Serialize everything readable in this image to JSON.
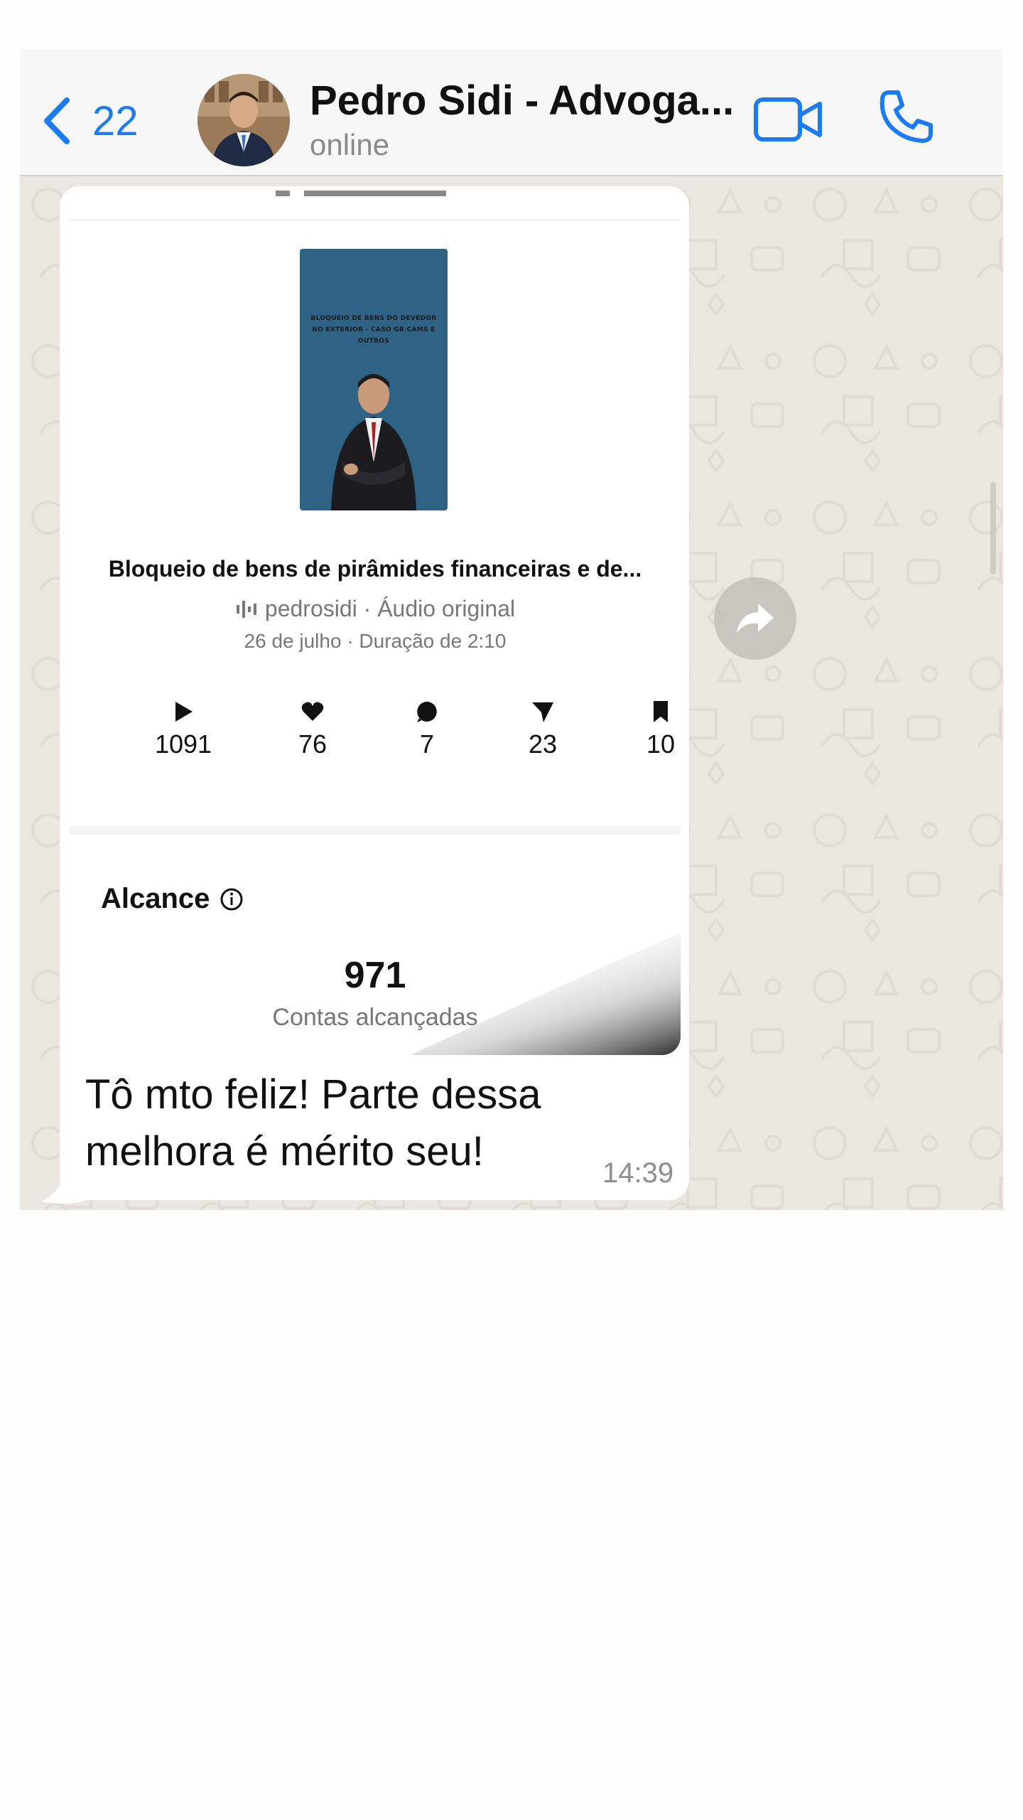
{
  "header": {
    "back_count": "22",
    "contact_name": "Pedro Sidi - Advoga...",
    "contact_status": "online",
    "accent_color": "#1a7cf0"
  },
  "message": {
    "reel": {
      "cover_text": "BLOQUEIO DE BENS DO DEVEDOR NO EXTERIOR - CASO GB CAMS E OUTROS",
      "title": "Bloqueio de bens de pirâmides financeiras e de...",
      "author": "pedrosidi · Áudio original",
      "date_duration": "26 de julho · Duração de 2:10",
      "stats": {
        "plays": "1091",
        "likes": "76",
        "comments": "7",
        "shares": "23",
        "saves": "10"
      },
      "reach_label": "Alcance",
      "reach_value": "971",
      "reach_caption": "Contas alcançadas"
    },
    "text": "Tô mto feliz! Parte dessa melhora é mérito seu!",
    "time": "14:39"
  },
  "icons": {
    "back": "chevron-left-icon",
    "video": "video-camera-icon",
    "call": "phone-icon",
    "forward": "forward-arrow-icon",
    "info": "info-icon"
  }
}
